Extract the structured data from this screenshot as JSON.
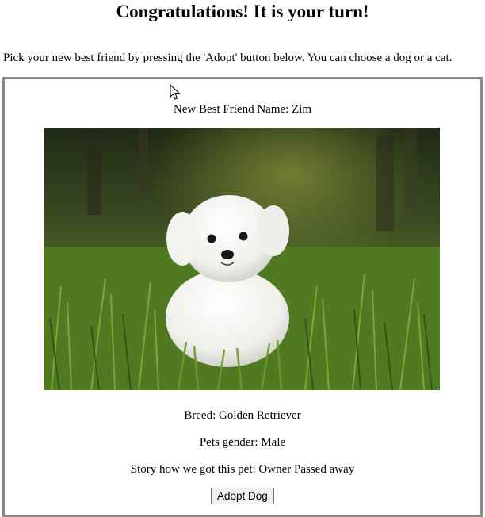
{
  "page": {
    "title": "Congratulations! It is your turn!",
    "intro": "Pick your new best friend by pressing the 'Adopt' button below. You can choose a dog or a cat."
  },
  "pet": {
    "name_line": "New Best Friend Name: Zim",
    "photo_alt": "Zim",
    "breed_line": "Breed: Golden Retriever",
    "gender_line": "Pets gender: Male",
    "story_line": "Story how we got this pet: Owner Passed away",
    "adopt_button_label": "Adopt Dog"
  },
  "colors": {
    "card_border": "#8a8a8a",
    "button_bg": "#efefef"
  }
}
